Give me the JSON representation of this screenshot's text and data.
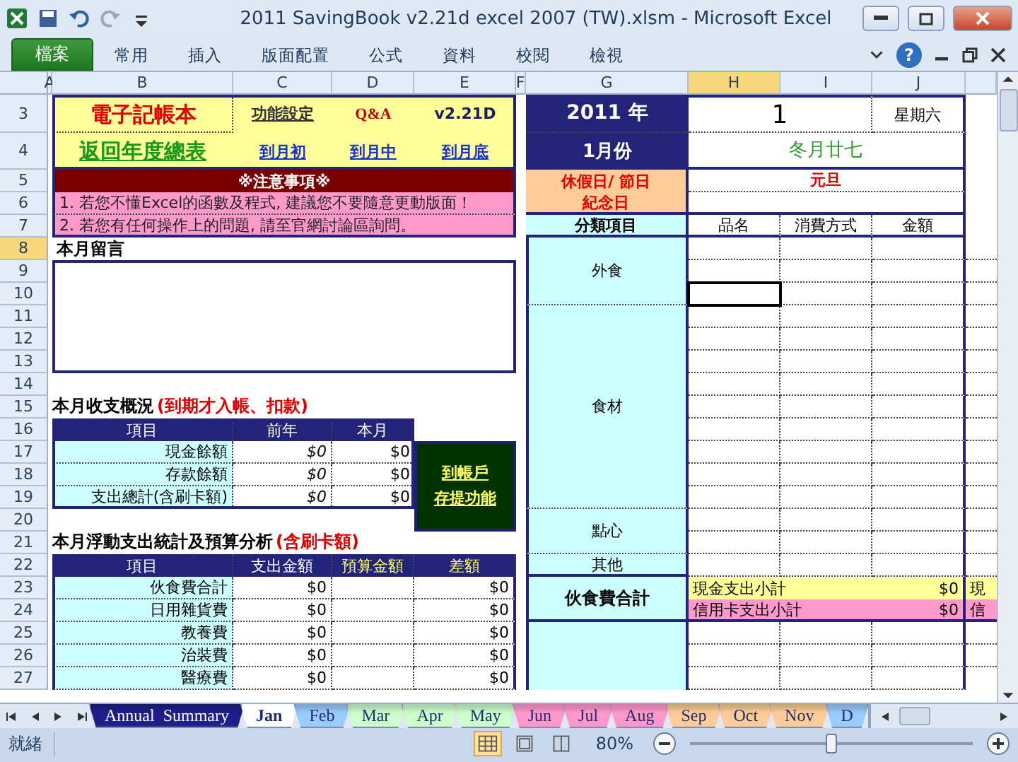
{
  "window": {
    "title": "2011 SavingBook v2.21d excel 2007 (TW).xlsm  -  Microsoft Excel"
  },
  "ribbon": {
    "file_tab": "檔案",
    "help": "?",
    "tabs": [
      {
        "label": "常用",
        "selected": false
      },
      {
        "label": "插入",
        "selected": false
      },
      {
        "label": "版面配置",
        "selected": false
      },
      {
        "label": "公式",
        "selected": false
      },
      {
        "label": "資料",
        "selected": false
      },
      {
        "label": "校閱",
        "selected": false
      },
      {
        "label": "檢視",
        "selected": false
      }
    ]
  },
  "columns": [
    {
      "label": "A",
      "selected": false
    },
    {
      "label": "B",
      "selected": false
    },
    {
      "label": "C",
      "selected": false
    },
    {
      "label": "D",
      "selected": false
    },
    {
      "label": "E",
      "selected": false
    },
    {
      "label": "F",
      "selected": false
    },
    {
      "label": "G",
      "selected": false
    },
    {
      "label": "H",
      "selected": true
    },
    {
      "label": "I",
      "selected": false
    },
    {
      "label": "J",
      "selected": false
    }
  ],
  "rows": [
    {
      "label": "3",
      "selected": false
    },
    {
      "label": "4",
      "selected": false
    },
    {
      "label": "5",
      "selected": false
    },
    {
      "label": "6",
      "selected": false
    },
    {
      "label": "7",
      "selected": false
    },
    {
      "label": "8",
      "selected": true
    },
    {
      "label": "9",
      "selected": false
    },
    {
      "label": "10",
      "selected": false
    },
    {
      "label": "11",
      "selected": false
    },
    {
      "label": "12",
      "selected": false
    },
    {
      "label": "13",
      "selected": false
    },
    {
      "label": "14",
      "selected": false
    },
    {
      "label": "15",
      "selected": false
    },
    {
      "label": "16",
      "selected": false
    },
    {
      "label": "17",
      "selected": false
    },
    {
      "label": "18",
      "selected": false
    },
    {
      "label": "19",
      "selected": false
    },
    {
      "label": "20",
      "selected": false
    },
    {
      "label": "21",
      "selected": false
    },
    {
      "label": "22",
      "selected": false
    },
    {
      "label": "23",
      "selected": false
    },
    {
      "label": "24",
      "selected": false
    },
    {
      "label": "25",
      "selected": false
    },
    {
      "label": "26",
      "selected": false
    },
    {
      "label": "27",
      "selected": false
    }
  ],
  "header_panel": {
    "title": "電子記帳本",
    "settings_link": "功能設定",
    "qa_link": "Q&A",
    "version": "v2.21D",
    "back_link": "返回年度總表",
    "nav_links": [
      "到月初",
      "到月中",
      "到月底"
    ]
  },
  "notice": {
    "title": "※注意事項※",
    "lines": [
      "1. 若您不懂Excel的函數及程式, 建議您不要隨意更動版面！",
      "2. 若您有任何操作上的問題, 請至官網討論區詢問。"
    ]
  },
  "memo": {
    "title": "本月留言"
  },
  "balance": {
    "title": "本月收支概況",
    "note": "(到期才入帳、扣款)",
    "headers": [
      "項目",
      "前年",
      "本月"
    ],
    "rows": [
      {
        "label": "現金餘額",
        "previous": "$0",
        "current": "$0"
      },
      {
        "label": "存款餘額",
        "previous": "$0",
        "current": "$0"
      },
      {
        "label": "支出總計(含刷卡額)",
        "previous": "$0",
        "current": "$0"
      }
    ],
    "link_lines": [
      "到帳戶",
      "存提功能"
    ]
  },
  "budget": {
    "title": "本月浮動支出統計及預算分析",
    "note": "(含刷卡額)",
    "headers": [
      "項目",
      "支出金額",
      "預算金額",
      "差額"
    ],
    "rows": [
      {
        "label": "伙食費合計",
        "spent": "$0",
        "difference": "$0"
      },
      {
        "label": "日用雜貨費",
        "spent": "$0",
        "difference": "$0"
      },
      {
        "label": "教養費",
        "spent": "$0",
        "difference": "$0"
      },
      {
        "label": "治裝費",
        "spent": "$0",
        "difference": "$0"
      },
      {
        "label": "醫療費",
        "spent": "$0",
        "difference": "$0"
      }
    ]
  },
  "day_panel": {
    "year": "2011 年",
    "day": "1",
    "weekday": "星期六",
    "month": "1月份",
    "lunar": "冬月廿七",
    "holiday_label": "休假日/ 節日",
    "holiday": "元旦",
    "anniversary_label": "紀念日",
    "headers": [
      "分類項目",
      "品名",
      "消費方式",
      "金額"
    ],
    "categories": [
      "外食",
      "食材",
      "點心",
      "其他"
    ],
    "total": {
      "label": "伙食費合計",
      "cash": "現金支出小計",
      "cash_amount": "$0",
      "cash_next": "現",
      "card": "信用卡支出小計",
      "card_amount": "$0",
      "card_next": "信"
    }
  },
  "sheet_tabs": [
    {
      "label": "Annual  Summary",
      "selected": false,
      "color": "#1f1f8c"
    },
    {
      "label": "Jan",
      "selected": true,
      "color": "#ffffff"
    },
    {
      "label": "Feb",
      "selected": false,
      "color": "#99ccff"
    },
    {
      "label": "Mar",
      "selected": false,
      "color": "#ccffcc"
    },
    {
      "label": "Apr",
      "selected": false,
      "color": "#ccffcc"
    },
    {
      "label": "May",
      "selected": false,
      "color": "#ccffcc"
    },
    {
      "label": "Jun",
      "selected": false,
      "color": "#ff99cc"
    },
    {
      "label": "Jul",
      "selected": false,
      "color": "#ff99cc"
    },
    {
      "label": "Aug",
      "selected": false,
      "color": "#ff99cc"
    },
    {
      "label": "Sep",
      "selected": false,
      "color": "#ffcc99"
    },
    {
      "label": "Oct",
      "selected": false,
      "color": "#ffcc99"
    },
    {
      "label": "Nov",
      "selected": false,
      "color": "#ffcc99"
    },
    {
      "label": "D",
      "selected": false,
      "color": "#99ccff"
    }
  ],
  "status_bar": {
    "status": "就緒",
    "zoom": "80%",
    "zoom_slider": {
      "level": 0.5
    },
    "views": [
      {
        "kind": "normal",
        "selected": true
      },
      {
        "kind": "layout",
        "selected": false
      },
      {
        "kind": "pagebreak",
        "selected": false
      }
    ]
  }
}
